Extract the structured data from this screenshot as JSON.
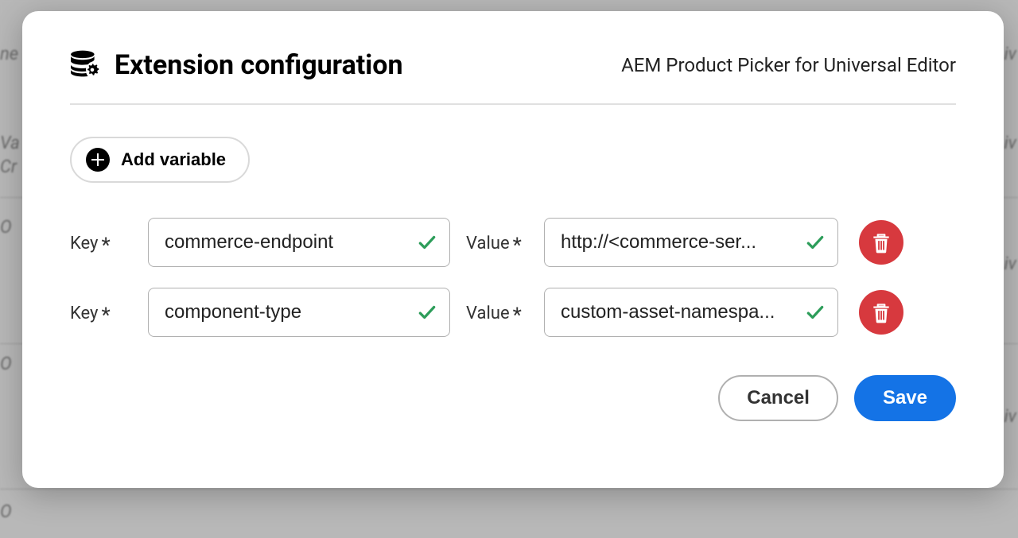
{
  "modal": {
    "title": "Extension configuration",
    "subtitle": "AEM Product Picker for Universal Editor",
    "add_variable_label": "Add variable"
  },
  "labels": {
    "key": "Key",
    "value": "Value",
    "required_marker": "*"
  },
  "rows": [
    {
      "key": "commerce-endpoint",
      "value": "http://<commerce-ser..."
    },
    {
      "key": "component-type",
      "value": "custom-asset-namespa..."
    }
  ],
  "footer": {
    "cancel": "Cancel",
    "save": "Save"
  },
  "colors": {
    "primary": "#1473e6",
    "danger": "#d7393e",
    "success_check": "#2d9d5a"
  }
}
